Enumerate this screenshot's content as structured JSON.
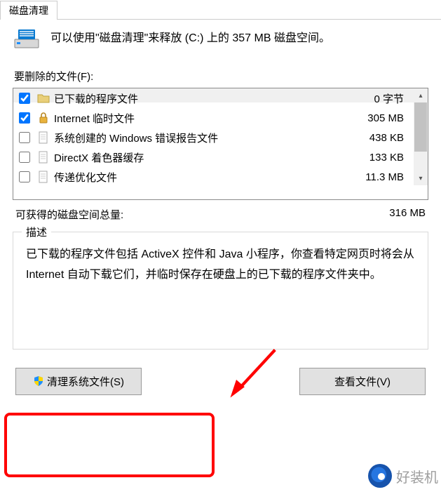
{
  "tab_label": "磁盘清理",
  "info_text": "可以使用\"磁盘清理\"来释放  (C:) 上的 357 MB 磁盘空间。",
  "files_label": "要删除的文件(F):",
  "files": [
    {
      "name": "已下载的程序文件",
      "size": "0 字节",
      "checked": true,
      "icon": "folder"
    },
    {
      "name": "Internet 临时文件",
      "size": "305 MB",
      "checked": true,
      "icon": "lock"
    },
    {
      "name": "系统创建的 Windows 错误报告文件",
      "size": "438 KB",
      "checked": false,
      "icon": "doc"
    },
    {
      "name": "DirectX 着色器缓存",
      "size": "133 KB",
      "checked": false,
      "icon": "doc"
    },
    {
      "name": "传递优化文件",
      "size": "11.3 MB",
      "checked": false,
      "icon": "doc"
    }
  ],
  "total_label": "可获得的磁盘空间总量:",
  "total_value": "316 MB",
  "desc_legend": "描述",
  "desc_text": "已下载的程序文件包括 ActiveX 控件和 Java 小程序，你查看特定网页时将会从 Internet 自动下载它们，并临时保存在硬盘上的已下载的程序文件夹中。",
  "buttons": {
    "clean_system": "清理系统文件(S)",
    "view_files": "查看文件(V)"
  },
  "watermark_text": "好装机"
}
